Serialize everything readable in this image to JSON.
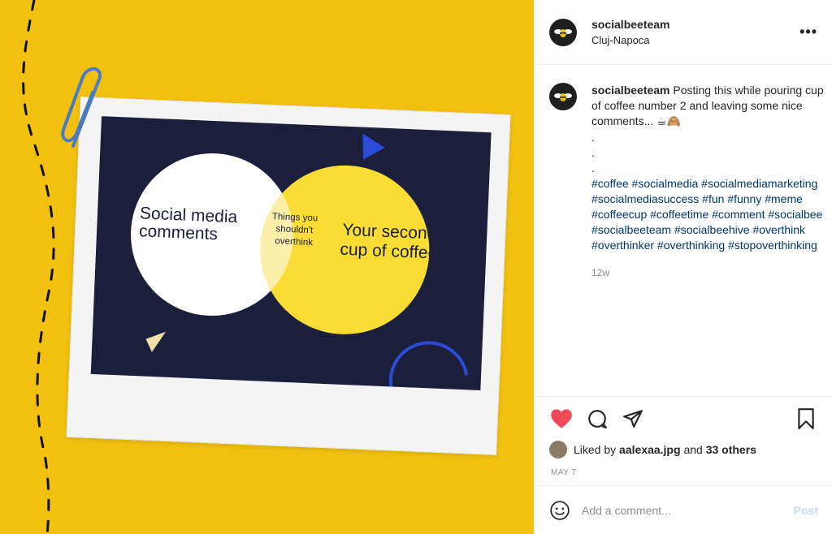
{
  "post": {
    "username": "socialbeeteam",
    "location": "Cluj-Napoca",
    "more_label": "•••"
  },
  "image": {
    "left_circle": [
      "Social media",
      "comments"
    ],
    "overlap": [
      "Things you",
      "shouldn't",
      "overthink"
    ],
    "right_circle": [
      "Your second",
      "cup of coffee"
    ]
  },
  "caption": {
    "username": "socialbeeteam",
    "text": "Posting this while pouring cup of coffee number 2 and leaving some nice comments... ☕🙈",
    "dots": [
      ".",
      ".",
      "."
    ],
    "hashtags": "#coffee #socialmedia #socialmediamarketing #socialmediasuccess #fun #funny #meme #coffeecup #coffeetime #comment #socialbee #socialbeeteam #socialbeehive #overthink #overthinker #overthinking #stopoverthinking",
    "time_ago": "12w"
  },
  "likes": {
    "prefix": "Liked by",
    "user": "aalexaa.jpg",
    "middle": "and",
    "others": "33 others"
  },
  "date": "MAY 7",
  "comment": {
    "placeholder": "Add a comment...",
    "post_label": "Post"
  },
  "colors": {
    "background_yellow": "#f2c10f",
    "navy": "#1c1f3c",
    "like_red": "#ed4956",
    "hashtag_blue": "#00376b"
  }
}
